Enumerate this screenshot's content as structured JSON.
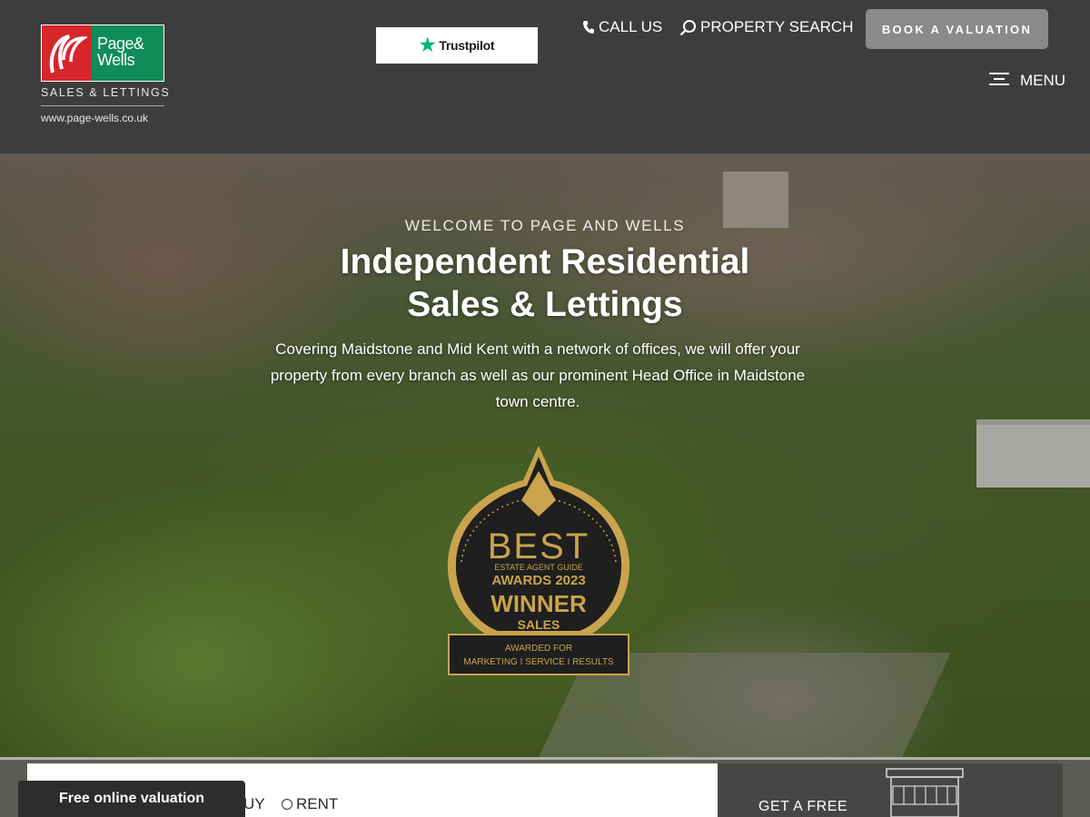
{
  "header": {
    "logo": {
      "wordmark_line1": "Page&",
      "wordmark_line2": "Wells",
      "tagline": "SALES & LETTINGS",
      "url": "www.page-wells.co.uk"
    },
    "trustpilot_label": "Trustpilot",
    "nav": {
      "call_label": "CALL US",
      "search_label": "PROPERTY SEARCH"
    },
    "valuation_button": "BOOK A VALUATION",
    "menu_label": "MENU"
  },
  "hero": {
    "kicker": "WELCOME TO PAGE AND WELLS",
    "title_line1": "Independent Residential",
    "title_line2": "Sales & Lettings",
    "text": "Covering Maidstone and Mid Kent with a network of offices, we will offer your property from every branch as well as our prominent Head Office in Maidstone town centre.",
    "badge": {
      "line1": "BEST",
      "line2": "ESTATE AGENT GUIDE",
      "line3": "AWARDS 2023",
      "line4": "WINNER",
      "line5": "SALES",
      "line6": "AWARDED FOR",
      "line7": "MARKETING I SERVICE I RESULTS"
    }
  },
  "search": {
    "options": [
      "BUY",
      "RENT"
    ],
    "visible_buy_fragment": "UY"
  },
  "free_valuation_tab": "Free online valuation",
  "valuation_panel": {
    "text": "GET A FREE"
  },
  "colors": {
    "header_bg": "#3d3d3d",
    "logo_red": "#d7262b",
    "logo_green": "#0f8c5a",
    "button_bg": "#8a8a8a",
    "badge_gold": "#c9a44c",
    "trustpilot_green": "#00b67a"
  }
}
